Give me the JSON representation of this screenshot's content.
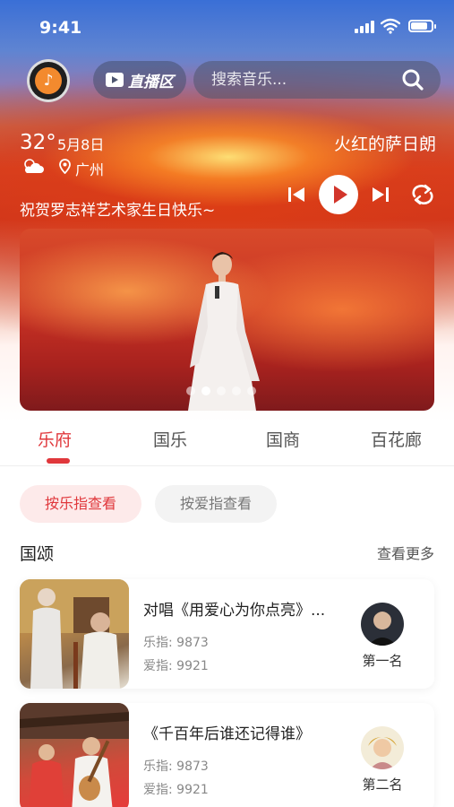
{
  "status_bar": {
    "time": "9:41",
    "battery_level": 0.8
  },
  "header": {
    "live_label": "直播区",
    "search_placeholder": "搜索音乐..."
  },
  "weather": {
    "temperature": "32°",
    "date": "5月8日",
    "city": "广州"
  },
  "player": {
    "song_title": "火红的萨日朗"
  },
  "banner": {
    "message": "祝贺罗志祥艺术家生日快乐~",
    "slide_count": 5,
    "active_slide": 1
  },
  "tabs": [
    {
      "label": "乐府",
      "active": true
    },
    {
      "label": "国乐",
      "active": false
    },
    {
      "label": "国商",
      "active": false
    },
    {
      "label": "百花廊",
      "active": false
    }
  ],
  "filters": [
    {
      "label": "按乐指查看",
      "active": true
    },
    {
      "label": "按爱指查看",
      "active": false
    }
  ],
  "section": {
    "title": "国颂",
    "more_label": "查看更多"
  },
  "songs": [
    {
      "title": "对唱《用爱心为你点亮》...",
      "music_index": "乐指: 9873",
      "love_index": "爱指: 9921",
      "rank": "第一名"
    },
    {
      "title": "《千百年后谁还记得谁》",
      "music_index": "乐指: 9873",
      "love_index": "爱指: 9921",
      "rank": "第二名"
    }
  ],
  "colors": {
    "accent": "#e0373b",
    "chip_active_bg": "#fdeaea",
    "chip_inactive_bg": "#f3f3f3"
  }
}
